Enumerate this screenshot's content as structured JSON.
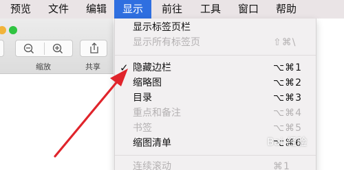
{
  "menubar": {
    "items": [
      "预览",
      "文件",
      "编辑",
      "显示",
      "前往",
      "工具",
      "窗口",
      "帮助"
    ],
    "active": "显示"
  },
  "toolbar": {
    "zoom_label": "缩放",
    "share_label": "共享"
  },
  "view_menu": {
    "items": [
      {
        "label": "显示标签页栏",
        "shortcut": "",
        "checked": false,
        "enabled": true
      },
      {
        "label": "显示所有标签页",
        "shortcut": "⇧⌘\\",
        "checked": false,
        "enabled": false
      },
      {
        "label": "隐藏边栏",
        "shortcut": "⌥⌘1",
        "checked": true,
        "enabled": true
      },
      {
        "label": "缩略图",
        "shortcut": "⌥⌘2",
        "checked": false,
        "enabled": true
      },
      {
        "label": "目录",
        "shortcut": "⌥⌘3",
        "checked": false,
        "enabled": true
      },
      {
        "label": "重点和备注",
        "shortcut": "⌥⌘4",
        "checked": false,
        "enabled": false
      },
      {
        "label": "书签",
        "shortcut": "⌥⌘5",
        "checked": false,
        "enabled": false
      },
      {
        "label": "缩图清单",
        "shortcut": "⌥⌘6",
        "checked": false,
        "enabled": true
      },
      {
        "label": "连续滚动",
        "shortcut": "⌘1",
        "checked": false,
        "enabled": false
      }
    ],
    "check_mark": "✓"
  },
  "watermark": "Bai 经验",
  "colors": {
    "menu_highlight": "#2f6fe0",
    "annotation_arrow": "#e0242b"
  }
}
